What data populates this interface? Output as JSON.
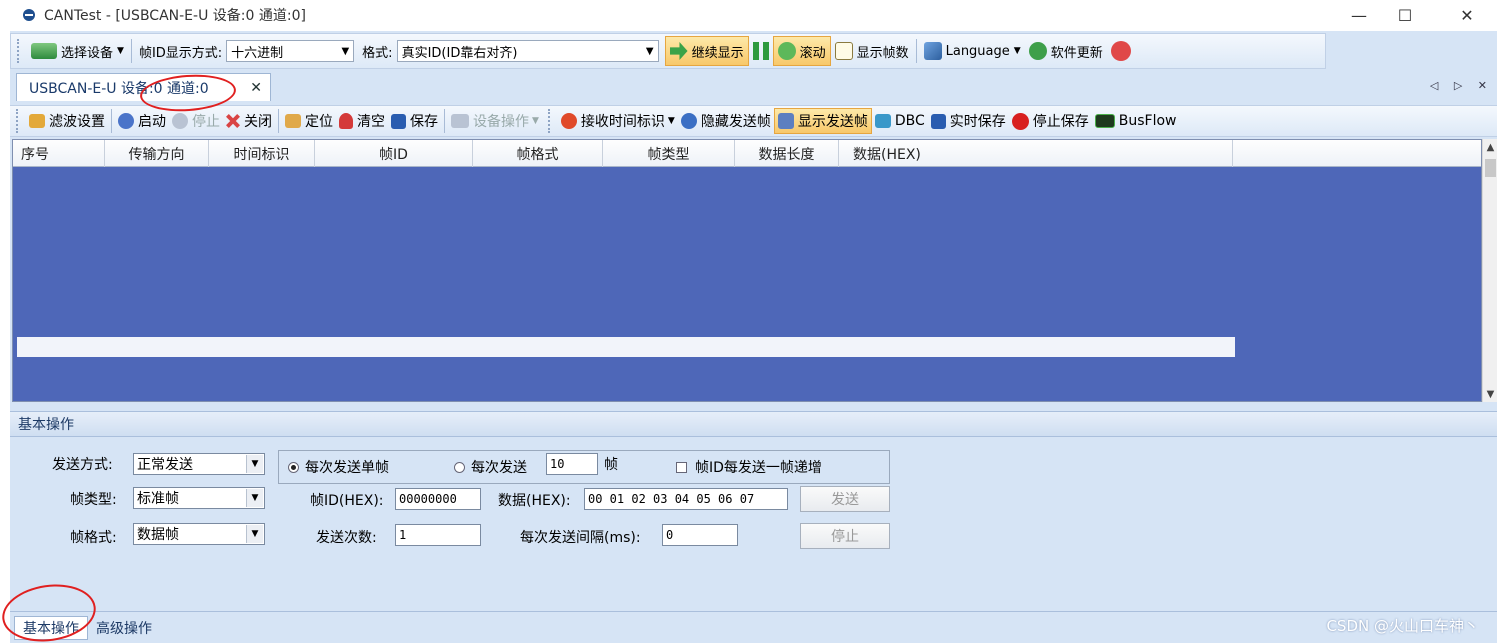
{
  "window": {
    "title": "CANTest  - [USBCAN-E-U 设备:0 通道:0]",
    "controls": {
      "minimize": "—",
      "maximize": "☐",
      "close": "✕"
    }
  },
  "toolbar1": {
    "select_device": "选择设备",
    "frame_id_display_label": "帧ID显示方式:",
    "frame_id_display_value": "十六进制",
    "format_label": "格式:",
    "format_value": "真实ID(ID靠右对齐)",
    "continue_display": "继续显示",
    "scroll": "滚动",
    "show_frame_count": "显示帧数",
    "language": "Language",
    "software_update": "软件更新"
  },
  "doc_tab": {
    "label": "USBCAN-E-U 设备:0 通道:0",
    "close": "✕"
  },
  "tab_nav": "◁ ▷ ✕",
  "toolbar2": {
    "filter_settings": "滤波设置",
    "start": "启动",
    "stop": "停止",
    "close": "关闭",
    "locate": "定位",
    "clear": "清空",
    "save": "保存",
    "device_ops": "设备操作",
    "rx_timestamp": "接收时间标识",
    "hide_sent": "隐藏发送帧",
    "show_sent": "显示发送帧",
    "dbc": "DBC",
    "realtime_save": "实时保存",
    "stop_save": "停止保存",
    "busflow": "BusFlow"
  },
  "grid": {
    "columns": [
      "序号",
      "传输方向",
      "时间标识",
      "帧ID",
      "帧格式",
      "帧类型",
      "数据长度",
      "数据(HEX)"
    ]
  },
  "basic_panel": {
    "header": "基本操作",
    "send_mode_label": "发送方式:",
    "send_mode_value": "正常发送",
    "radio_single": "每次发送单帧",
    "radio_multi": "每次发送",
    "multi_count": "10",
    "frame_unit": "帧",
    "increment_label": "帧ID每发送一帧递增",
    "frame_type_label": "帧类型:",
    "frame_type_value": "标准帧",
    "frame_id_label": "帧ID(HEX):",
    "frame_id_value": "00000000",
    "data_label": "数据(HEX):",
    "data_value": "00 01 02 03 04 05 06 07",
    "send_button": "发送",
    "frame_format_label": "帧格式:",
    "frame_format_value": "数据帧",
    "send_count_label": "发送次数:",
    "send_count_value": "1",
    "interval_label": "每次发送间隔(ms):",
    "interval_value": "0",
    "stop_button": "停止"
  },
  "bottom_tabs": {
    "basic": "基本操作",
    "advanced": "高级操作"
  },
  "watermark": "CSDN @火山口车神丶",
  "colors": {
    "grid_bg": "#4e67b8",
    "frame_bg": "#d6e4f5",
    "active_tool": "#f8c86a",
    "annotation": "#e02020"
  }
}
